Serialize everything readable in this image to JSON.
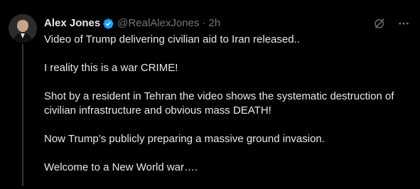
{
  "post": {
    "author": {
      "display_name": "Alex Jones",
      "handle": "@RealAlexJones",
      "separator": "·",
      "time": "2h"
    },
    "icons": {
      "verified": "verified-badge-icon",
      "grok": "grok-icon",
      "more": "more-icon"
    },
    "paragraphs": [
      "Video of Trump delivering civilian aid to Iran released..",
      "I reality this is a war CRIME!",
      "Shot  by a resident in Tehran the video shows the systematic destruction of civilian infrastructure and obvious mass DEATH!",
      "Now Trump’s publicly preparing a massive ground invasion.",
      "Welcome to a New World war…."
    ]
  },
  "colors": {
    "background": "#000000",
    "text": "#e7e9ea",
    "secondary": "#71767b",
    "verified": "#1d9bf0",
    "thread_line": "#333639"
  }
}
